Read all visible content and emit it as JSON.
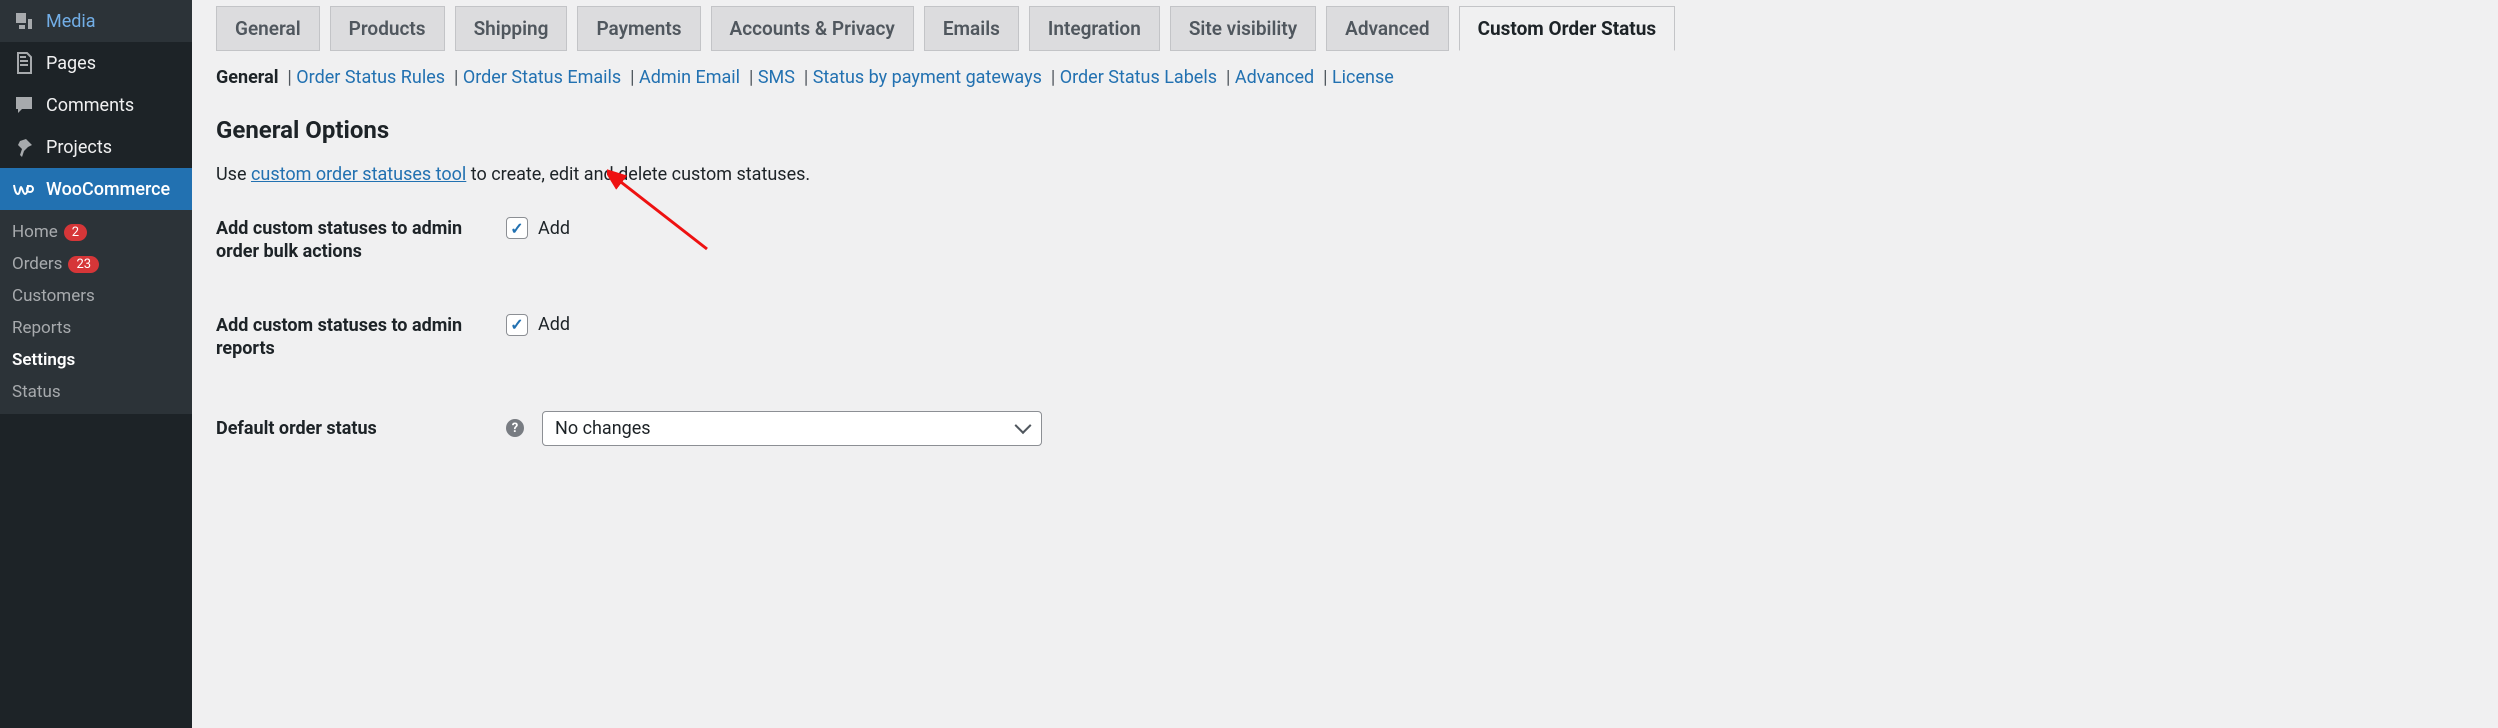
{
  "sidebar": {
    "items": [
      {
        "label": "Media",
        "icon": "media"
      },
      {
        "label": "Pages",
        "icon": "pages"
      },
      {
        "label": "Comments",
        "icon": "comments"
      },
      {
        "label": "Projects",
        "icon": "projects"
      },
      {
        "label": "WooCommerce",
        "icon": "woocommerce",
        "current": true
      }
    ],
    "submenu": [
      {
        "label": "Home",
        "badge": "2"
      },
      {
        "label": "Orders",
        "badge": "23"
      },
      {
        "label": "Customers"
      },
      {
        "label": "Reports"
      },
      {
        "label": "Settings",
        "current": true
      },
      {
        "label": "Status"
      }
    ]
  },
  "tabs": [
    {
      "label": "General"
    },
    {
      "label": "Products"
    },
    {
      "label": "Shipping"
    },
    {
      "label": "Payments"
    },
    {
      "label": "Accounts & Privacy"
    },
    {
      "label": "Emails"
    },
    {
      "label": "Integration"
    },
    {
      "label": "Site visibility"
    },
    {
      "label": "Advanced"
    },
    {
      "label": "Custom Order Status",
      "active": true
    }
  ],
  "sublinks": [
    {
      "label": "General",
      "current": true
    },
    {
      "label": "Order Status Rules"
    },
    {
      "label": "Order Status Emails"
    },
    {
      "label": "Admin Email"
    },
    {
      "label": "SMS"
    },
    {
      "label": "Status by payment gateways"
    },
    {
      "label": "Order Status Labels"
    },
    {
      "label": "Advanced"
    },
    {
      "label": "License"
    }
  ],
  "heading": "General Options",
  "intro": {
    "prefix": "Use ",
    "link": "custom order statuses tool",
    "suffix": " to create, edit and delete custom statuses."
  },
  "fields": {
    "bulk": {
      "label": "Add custom statuses to admin order bulk actions",
      "checkbox_label": "Add",
      "checked": true
    },
    "reports": {
      "label": "Add custom statuses to admin reports",
      "checkbox_label": "Add",
      "checked": true
    },
    "default": {
      "label": "Default order status",
      "select_value": "No changes"
    }
  }
}
